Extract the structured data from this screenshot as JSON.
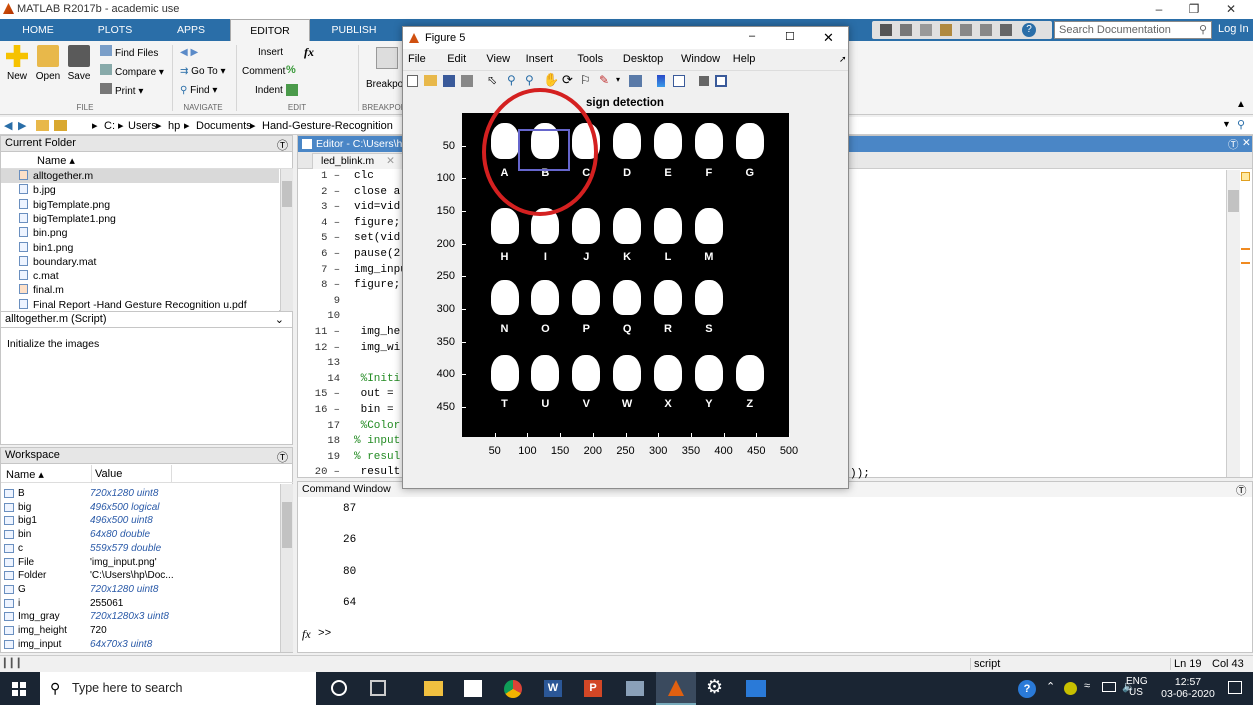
{
  "window": {
    "title": "MATLAB R2017b - academic use"
  },
  "tabs": [
    "HOME",
    "PLOTS",
    "APPS",
    "EDITOR",
    "PUBLISH"
  ],
  "search": {
    "placeholder": "Search Documentation"
  },
  "login": "Log In",
  "ribbon": {
    "new": "New",
    "open": "Open",
    "save": "Save",
    "find_files": "Find Files",
    "compare": "Compare",
    "print": "Print",
    "go_to": "Go To",
    "find": "Find",
    "insert": "Insert",
    "comment": "Comment",
    "indent": "Indent",
    "breakpoints": "Breakpoi",
    "groups": {
      "file": "FILE",
      "navigate": "NAVIGATE",
      "edit": "EDIT",
      "breakpoints": "BREAKPOIN"
    }
  },
  "address": [
    "C:",
    "Users",
    "hp",
    "Documents",
    "Hand-Gesture-Recognition"
  ],
  "current_folder": {
    "title": "Current Folder",
    "column": "Name ▴",
    "files": [
      "alltogether.m",
      "b.jpg",
      "bigTemplate.png",
      "bigTemplate1.png",
      "bin.png",
      "bin1.png",
      "boundary.mat",
      "c.mat",
      "final.m",
      "Final Report -Hand Gesture Recognition u.pdf"
    ]
  },
  "details": {
    "title": "alltogether.m  (Script)",
    "text": "Initialize the images"
  },
  "workspace": {
    "title": "Workspace",
    "col_name": "Name ▴",
    "col_value": "Value",
    "vars": [
      {
        "name": "B",
        "value": "720x1280 uint8"
      },
      {
        "name": "big",
        "value": "496x500 logical"
      },
      {
        "name": "big1",
        "value": "496x500 uint8"
      },
      {
        "name": "bin",
        "value": "64x80 double"
      },
      {
        "name": "c",
        "value": "559x579 double"
      },
      {
        "name": "File",
        "value": "'img_input.png'"
      },
      {
        "name": "Folder",
        "value": "'C:\\Users\\hp\\Doc..."
      },
      {
        "name": "G",
        "value": "720x1280 uint8"
      },
      {
        "name": "i",
        "value": "255061"
      },
      {
        "name": "Img_gray",
        "value": "720x1280x3 uint8"
      },
      {
        "name": "img_height",
        "value": "720"
      },
      {
        "name": "img_input",
        "value": "64x70x3 uint8"
      }
    ]
  },
  "editor": {
    "title": "Editor - C:\\Users\\hp\\",
    "tab": "led_blink.m",
    "line_numbers": [
      "1 –",
      "2 –",
      "3 –",
      "4 –",
      "5 –",
      "6 –",
      "7 –",
      "8 –",
      "9",
      "10",
      "11 –",
      "12 –",
      "13",
      "14",
      "15 –",
      "16 –",
      "17",
      "18",
      "19",
      "20 –"
    ],
    "lines": [
      "clc",
      "close a",
      "vid=vid",
      "figure;",
      "set(vid",
      "pause(2",
      "img_inpu",
      "figure;",
      "",
      "",
      " img_he",
      " img_wi",
      "",
      " %Initi",
      " out = ",
      " bin = ",
      " %Color",
      "% input",
      "% resul",
      " result"
    ],
    "tail": "));"
  },
  "command_window": {
    "title": "Command Window",
    "outputs": [
      "87",
      "26",
      "80",
      "64"
    ],
    "prompt": ">>"
  },
  "figure": {
    "title": "Figure 5",
    "menu": [
      "File",
      "Edit",
      "View",
      "Insert",
      "Tools",
      "Desktop",
      "Window",
      "Help"
    ],
    "plot_title": "sign detection",
    "yticks": [
      "50",
      "100",
      "150",
      "200",
      "250",
      "300",
      "350",
      "400",
      "450"
    ],
    "xticks": [
      "50",
      "100",
      "150",
      "200",
      "250",
      "300",
      "350",
      "400",
      "450",
      "500"
    ],
    "letters": [
      "A",
      "B",
      "C",
      "D",
      "E",
      "F",
      "G",
      "H",
      "I",
      "J",
      "K",
      "L",
      "M",
      "N",
      "O",
      "P",
      "Q",
      "R",
      "S",
      "T",
      "U",
      "V",
      "W",
      "X",
      "Y",
      "Z"
    ]
  },
  "status": {
    "mode": "script",
    "ln": "Ln  19",
    "col": "Col  43"
  },
  "taskbar": {
    "search": "Type here to search",
    "lang1": "ENG",
    "lang2": "US",
    "time": "12:57",
    "date": "03-06-2020"
  },
  "colors": {
    "matlab_blue": "#2a6ea8",
    "taskbar": "#1a2533",
    "highlight_circle": "#d42020",
    "selection_box": "#6666cc"
  }
}
